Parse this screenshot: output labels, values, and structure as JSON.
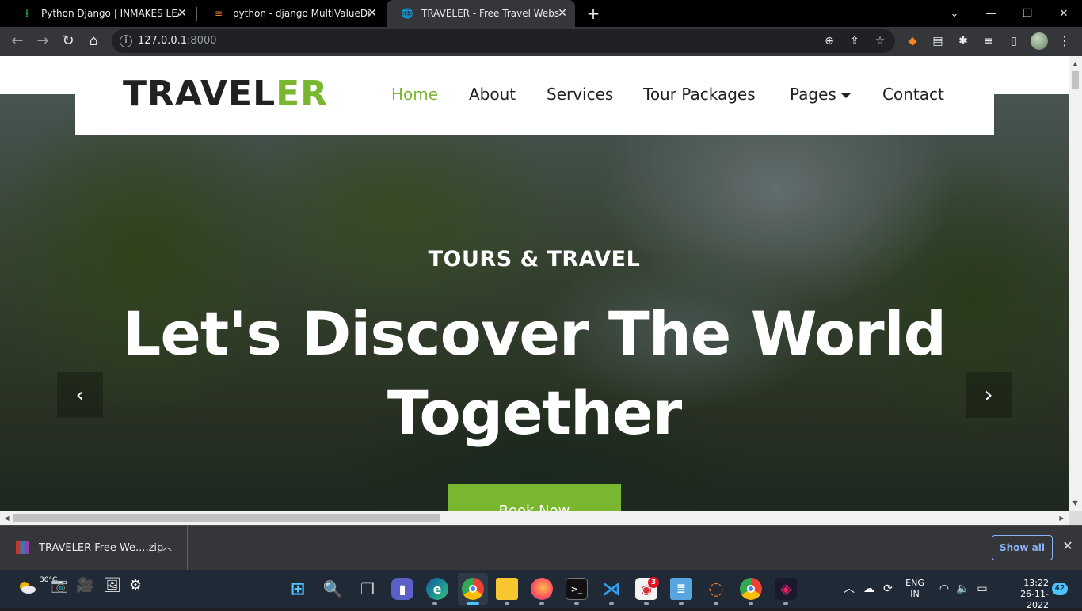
{
  "browser": {
    "tabs": [
      {
        "title": "Python Django | INMAKES LEARN",
        "icon": "django-favicon",
        "active": false
      },
      {
        "title": "python - django MultiValueDictK",
        "icon": "stackoverflow-favicon",
        "active": false
      },
      {
        "title": "TRAVELER - Free Travel Website T",
        "icon": "globe-favicon",
        "active": true
      }
    ],
    "url_host": "127.0.0.1",
    "url_port": ":8000",
    "colors": {
      "tab_active": "#35363a",
      "strip": "#000000"
    }
  },
  "site": {
    "logo_main": "TRAVEL",
    "logo_accent": "ER",
    "accent_color": "#7ab730",
    "nav": [
      {
        "label": "Home",
        "active": true
      },
      {
        "label": "About",
        "active": false
      },
      {
        "label": "Services",
        "active": false
      },
      {
        "label": "Tour Packages",
        "active": false
      },
      {
        "label": "Pages",
        "active": false,
        "dropdown": true
      },
      {
        "label": "Contact",
        "active": false
      }
    ],
    "hero": {
      "subtitle": "TOURS & TRAVEL",
      "title": "Let's Discover The World Together",
      "button": "Book Now",
      "prev_icon": "chevron-left-icon",
      "next_icon": "chevron-right-icon"
    }
  },
  "downloads": {
    "file_name": "TRAVELER Free We....zip",
    "show_all": "Show all"
  },
  "taskbar": {
    "weather_temp": "30°C",
    "lang_top": "ENG",
    "lang_bottom": "IN",
    "time": "13:22",
    "date": "26-11-2022",
    "notifications": "42",
    "badge_count": "3",
    "apps": [
      "start",
      "search",
      "task-view",
      "teams-chat",
      "edge",
      "chrome",
      "file-explorer",
      "firefox",
      "terminal",
      "vscode",
      "app-3",
      "notepad",
      "jupyter",
      "chrome-profile",
      "app-red"
    ]
  }
}
